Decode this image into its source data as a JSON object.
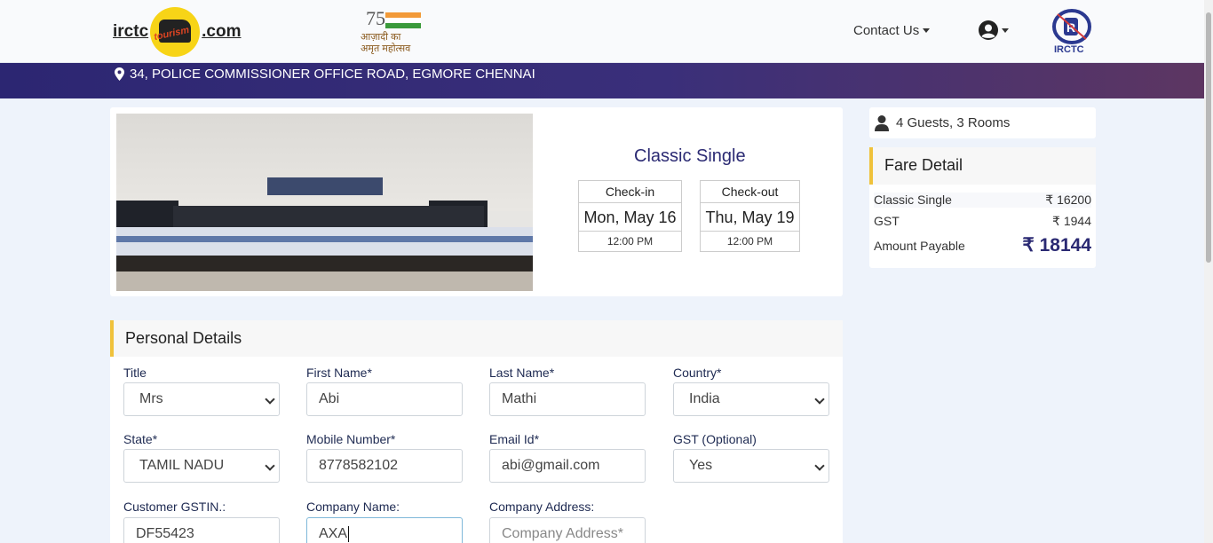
{
  "header": {
    "logo_left": "irctc",
    "logo_right": ".com",
    "logo_script": "tourism",
    "azadi_number": "75",
    "azadi_text_line1": "आज़ादी का",
    "azadi_text_line2": "अमृत महोत्सव",
    "contact_label": "Contact Us",
    "irctc_label": "IRCTC"
  },
  "banner": {
    "address": "34, POLICE COMMISSIONER OFFICE ROAD, EGMORE CHENNAI"
  },
  "room": {
    "title": "Classic Single",
    "checkin": {
      "label": "Check-in",
      "day": "Mon, May 16",
      "time": "12:00 PM"
    },
    "checkout": {
      "label": "Check-out",
      "day": "Thu, May 19",
      "time": "12:00 PM"
    }
  },
  "guests": "4 Guests, 3 Rooms",
  "fare": {
    "title": "Fare Detail",
    "rows": [
      {
        "label": "Classic Single",
        "value": "₹ 16200"
      },
      {
        "label": "GST",
        "value": "₹ 1944"
      },
      {
        "label": "Amount Payable",
        "value": "₹ 18144"
      }
    ]
  },
  "personal": {
    "title": "Personal Details",
    "fields": {
      "title": {
        "label": "Title",
        "value": "Mrs"
      },
      "first_name": {
        "label": "First Name*",
        "value": "Abi"
      },
      "last_name": {
        "label": "Last Name*",
        "value": "Mathi"
      },
      "country": {
        "label": "Country*",
        "value": "India"
      },
      "state": {
        "label": "State*",
        "value": "TAMIL NADU"
      },
      "mobile": {
        "label": "Mobile Number*",
        "value": "8778582102"
      },
      "email": {
        "label": "Email Id*",
        "value": "abi@gmail.com"
      },
      "gst": {
        "label": "GST (Optional)",
        "value": "Yes"
      },
      "gstin": {
        "label": "Customer GSTIN.:",
        "value": "DF55423"
      },
      "company_name": {
        "label": "Company Name:",
        "value": "AXA"
      },
      "company_address": {
        "label": "Company Address:",
        "placeholder": "Company Address*"
      }
    }
  },
  "colors": {
    "brand_navy": "#2b2a73",
    "accent_yellow": "#f0c23b",
    "page_bg": "#eef3fb"
  }
}
